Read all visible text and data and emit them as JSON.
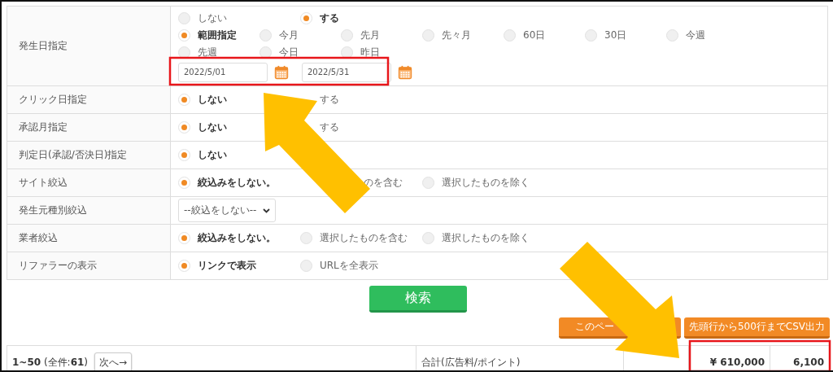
{
  "filters": [
    {
      "label": "発生日指定",
      "kind": "date",
      "options": [
        {
          "label": "しない",
          "selected": false
        },
        {
          "label": "する",
          "selected": true
        }
      ],
      "range_options": [
        {
          "label": "範囲指定",
          "selected": true
        },
        {
          "label": "今月",
          "selected": false
        },
        {
          "label": "先月",
          "selected": false
        },
        {
          "label": "先々月",
          "selected": false
        },
        {
          "label": "60日",
          "selected": false
        },
        {
          "label": "30日",
          "selected": false
        },
        {
          "label": "今週",
          "selected": false
        },
        {
          "label": "先週",
          "selected": false
        },
        {
          "label": "今日",
          "selected": false
        },
        {
          "label": "昨日",
          "selected": false
        }
      ],
      "dates": [
        {
          "value": "2022/5/01"
        },
        {
          "value": "2022/5/31"
        }
      ]
    },
    {
      "label": "クリック日指定",
      "kind": "radio",
      "options": [
        {
          "kind": "radio",
          "label": "しない",
          "selected": true
        },
        {
          "kind": "text",
          "label": "する"
        }
      ]
    },
    {
      "label": "承認月指定",
      "kind": "radio",
      "options": [
        {
          "kind": "radio",
          "label": "しない",
          "selected": true
        },
        {
          "kind": "text",
          "label": "する"
        }
      ]
    },
    {
      "label": "判定日(承認/否決日)指定",
      "kind": "radio",
      "options": [
        {
          "label": "しない",
          "selected": true
        }
      ]
    },
    {
      "label": "サイト絞込",
      "kind": "radio",
      "options": [
        {
          "kind": "radio",
          "label": "絞込みをしない。",
          "selected": true
        },
        {
          "kind": "tail",
          "label": "のを含む"
        },
        {
          "kind": "radio",
          "label": "選択したものを除く",
          "selected": false
        }
      ]
    },
    {
      "label": "発生元種別絞込",
      "kind": "select",
      "value": "--絞込をしない--"
    },
    {
      "label": "業者絞込",
      "kind": "radio",
      "options": [
        {
          "label": "絞込みをしない。",
          "selected": true
        },
        {
          "label": "選択したものを含む",
          "selected": false
        },
        {
          "label": "選択したものを除く",
          "selected": false
        }
      ]
    },
    {
      "label": "リファラーの表示",
      "kind": "radio",
      "options": [
        {
          "label": "リンクで表示",
          "selected": true
        },
        {
          "label": "URLを全表示",
          "selected": false
        }
      ]
    }
  ],
  "search_button": "検索",
  "csv_buttons": [
    {
      "label": "このペー"
    },
    {
      "label": "先頭行から500行までCSV出力"
    }
  ],
  "summary": {
    "range": "**1~50** (全件:**61**)",
    "next_button": "次へ→",
    "total_label": "合計(広告料/ポイント)",
    "amount": "¥ 610,000",
    "points": "6,100"
  }
}
